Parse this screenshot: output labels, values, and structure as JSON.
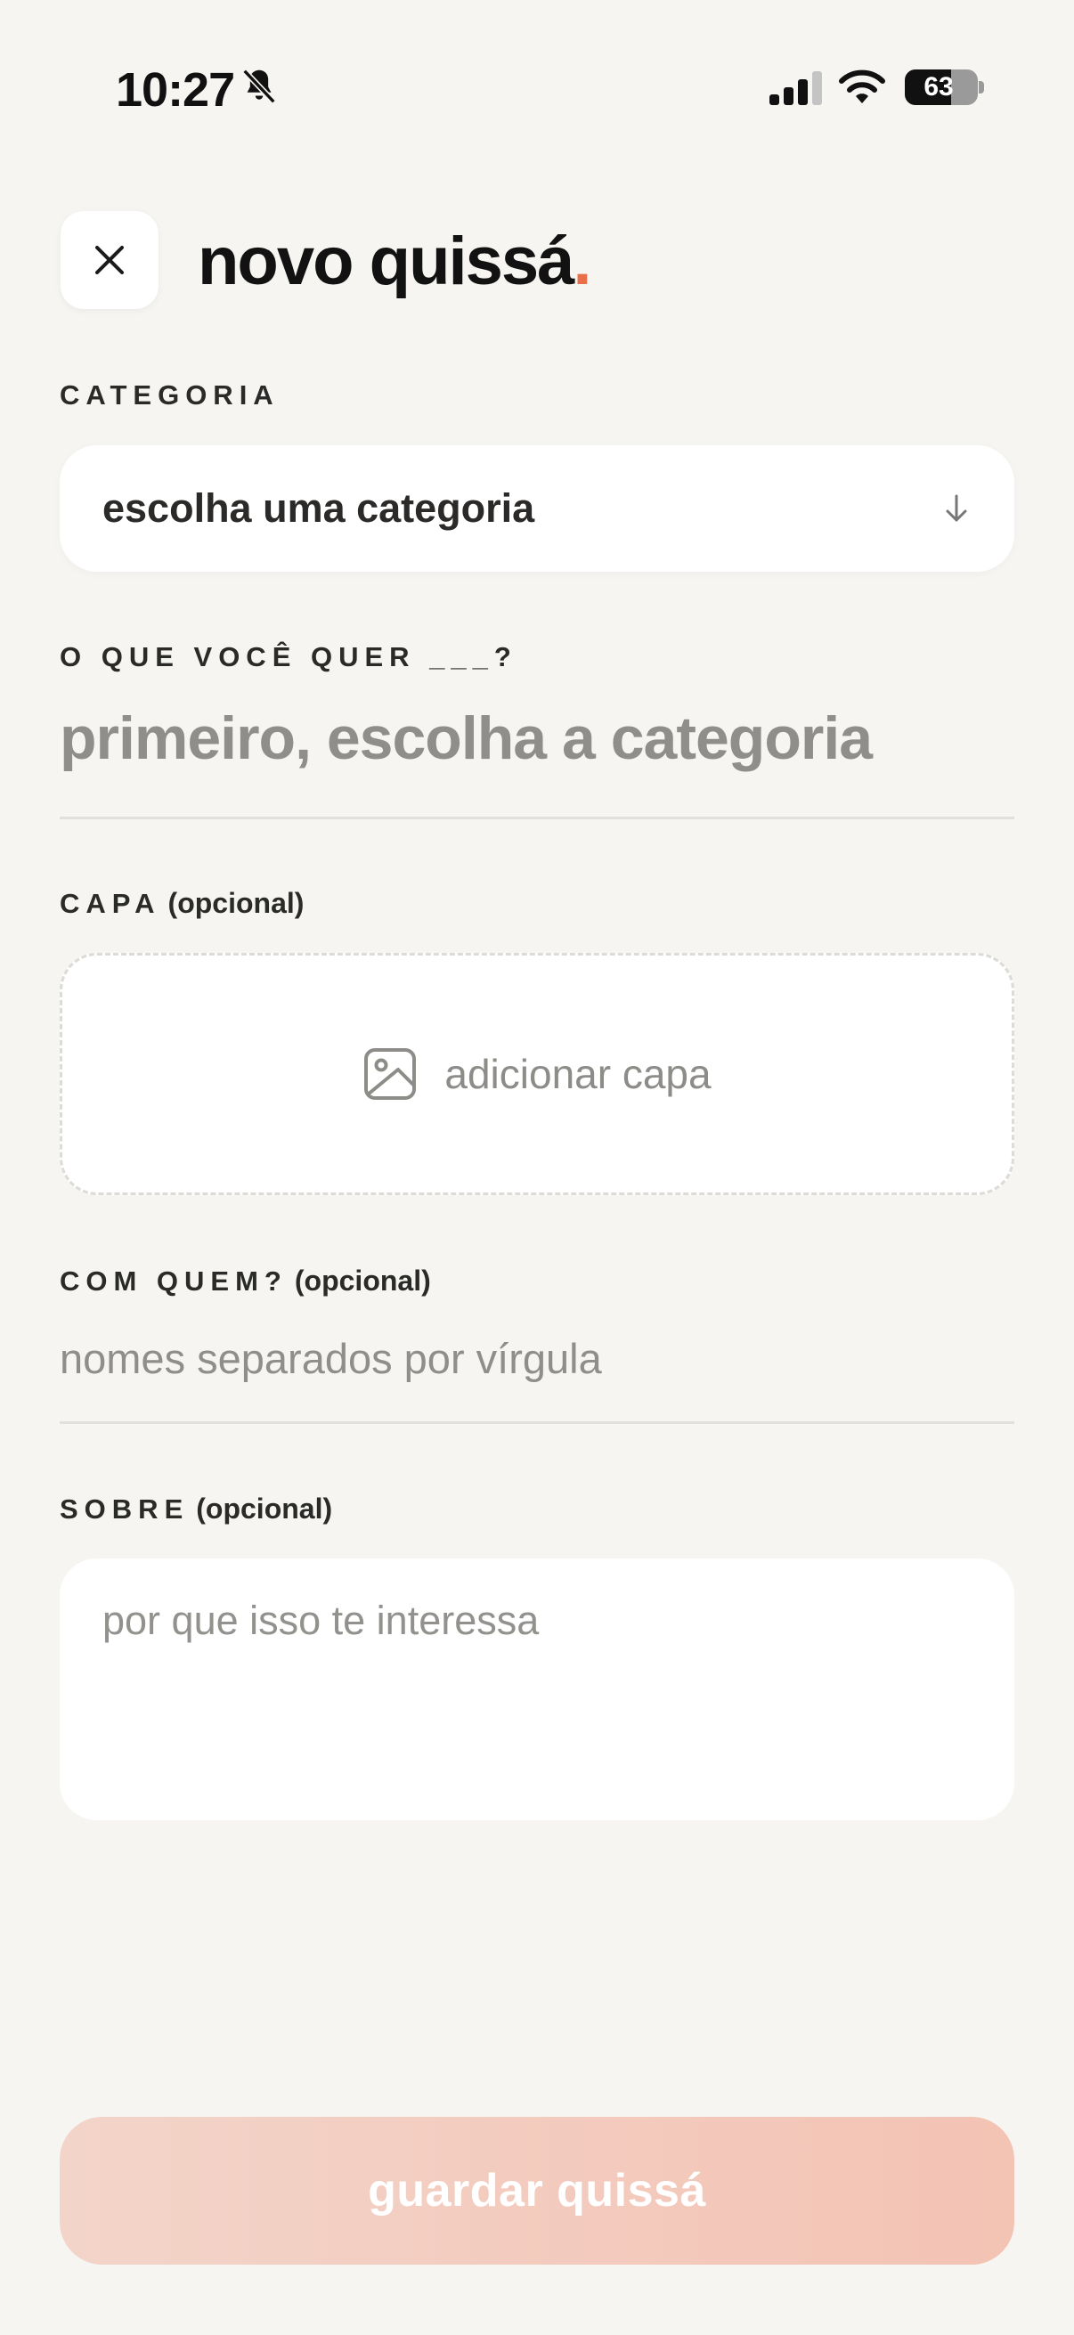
{
  "status_bar": {
    "time": "10:27",
    "battery": "63"
  },
  "header": {
    "title": "novo quissá",
    "title_dot": ".",
    "close_icon": "close-icon"
  },
  "form": {
    "category": {
      "label": "CATEGORIA",
      "placeholder": "escolha uma categoria"
    },
    "what": {
      "label": "O QUE VOCÊ QUER ___?",
      "placeholder": "primeiro, escolha a categoria"
    },
    "cover": {
      "label": "CAPA",
      "optional": "(opcional)",
      "button_label": "adicionar capa",
      "icon": "image-icon"
    },
    "with_whom": {
      "label": "COM QUEM?",
      "optional": "(opcional)",
      "placeholder": "nomes separados por vírgula"
    },
    "about": {
      "label": "SOBRE",
      "optional": "(opcional)",
      "placeholder": "por que isso te interessa"
    },
    "save_label": "guardar quissá"
  },
  "colors": {
    "accent": "#e96e4a",
    "background": "#f6f5f2",
    "save_button": "#f3c7b9"
  }
}
